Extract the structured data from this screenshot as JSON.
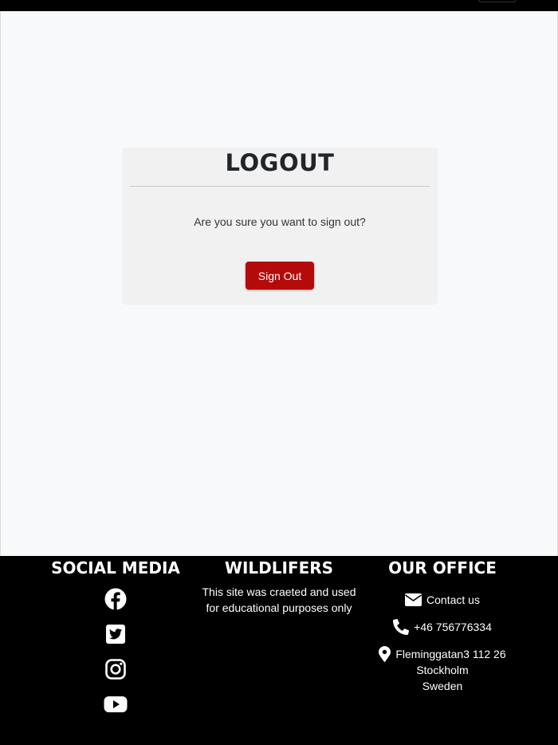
{
  "card": {
    "title": "LOGOUT",
    "message": "Are you sure you want to sign out?",
    "button_label": "Sign Out"
  },
  "footer": {
    "social": {
      "heading": "SOCIAL MEDIA",
      "icons": [
        "facebook-icon",
        "twitter-icon",
        "instagram-icon",
        "youtube-icon"
      ]
    },
    "about": {
      "heading": "WILDLIFERS",
      "line1": "This site was craeted and used",
      "line2": "for educational purposes only"
    },
    "office": {
      "heading": "OUR OFFICE",
      "contact": "Contact us",
      "phone": "+46 756776334",
      "address_line1": "Fleminggatan3 112 26",
      "address_line2": "Stockholm",
      "address_line3": "Sweden"
    }
  },
  "colors": {
    "button": "#b50a0a",
    "footer_bg": "#000000",
    "page_bg": "#f8f9fa",
    "card_bg": "#f1f1f1"
  }
}
